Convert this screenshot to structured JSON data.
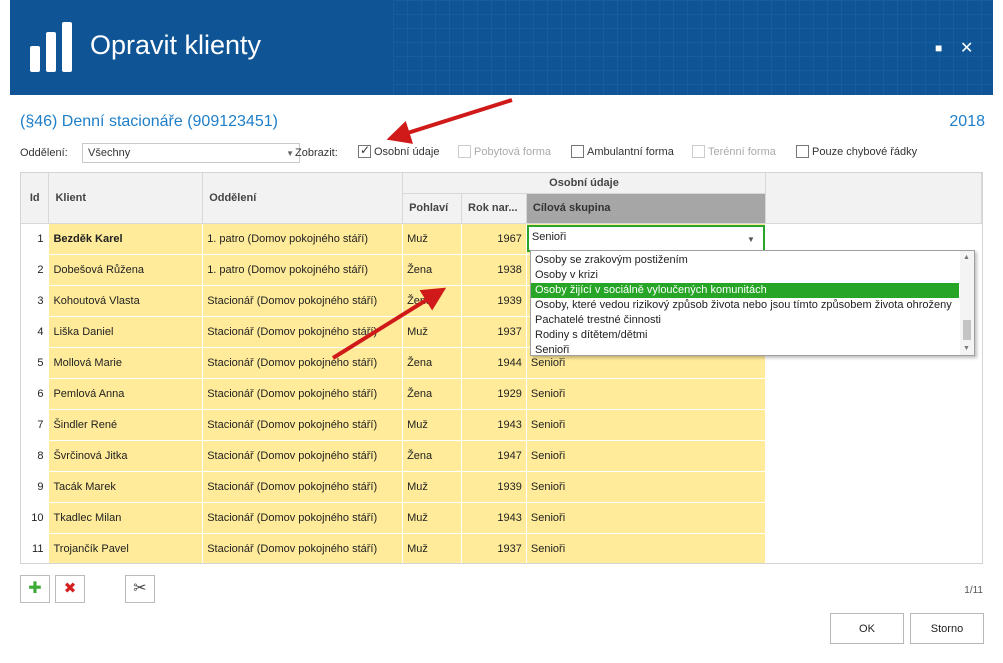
{
  "window": {
    "title": "Opravit klienty",
    "maximize_glyph": "■",
    "close_glyph": "✕"
  },
  "header": {
    "subtitle": "(§46) Denní stacionáře (909123451)",
    "year": "2018"
  },
  "filters": {
    "department_label": "Oddělení:",
    "department_value": "Všechny",
    "show_label": "Zobrazit:",
    "checkboxes": [
      {
        "label": "Osobní údaje",
        "checked": true,
        "disabled": false
      },
      {
        "label": "Pobytová forma",
        "checked": false,
        "disabled": true
      },
      {
        "label": "Ambulantní forma",
        "checked": false,
        "disabled": false
      },
      {
        "label": "Terénní forma",
        "checked": false,
        "disabled": true
      },
      {
        "label": "Pouze chybové řádky",
        "checked": false,
        "disabled": false
      }
    ]
  },
  "grid": {
    "headers": {
      "id": "Id",
      "client": "Klient",
      "department": "Oddělení",
      "group": "Osobní údaje",
      "gender": "Pohlaví",
      "birth_year": "Rok nar...",
      "target_group": "Cílová skupina"
    },
    "rows": [
      {
        "id": "1",
        "client": "Bezděk Karel",
        "department": "1. patro (Domov pokojného stáří)",
        "gender": "Muž",
        "year": "1967",
        "target": "Senioři"
      },
      {
        "id": "2",
        "client": "Dobešová Růžena",
        "department": "1. patro (Domov pokojného stáří)",
        "gender": "Žena",
        "year": "1938",
        "target": ""
      },
      {
        "id": "3",
        "client": "Kohoutová Vlasta",
        "department": "Stacionář (Domov pokojného stáří)",
        "gender": "Žena",
        "year": "1939",
        "target": ""
      },
      {
        "id": "4",
        "client": "Liška Daniel",
        "department": "Stacionář (Domov pokojného stáří)",
        "gender": "Muž",
        "year": "1937",
        "target": ""
      },
      {
        "id": "5",
        "client": "Mollová Marie",
        "department": "Stacionář (Domov pokojného stáří)",
        "gender": "Žena",
        "year": "1944",
        "target": "Senioři"
      },
      {
        "id": "6",
        "client": "Pemlová Anna",
        "department": "Stacionář (Domov pokojného stáří)",
        "gender": "Žena",
        "year": "1929",
        "target": "Senioři"
      },
      {
        "id": "7",
        "client": "Šindler René",
        "department": "Stacionář (Domov pokojného stáří)",
        "gender": "Muž",
        "year": "1943",
        "target": "Senioři"
      },
      {
        "id": "8",
        "client": "Švrčinová Jitka",
        "department": "Stacionář (Domov pokojného stáří)",
        "gender": "Žena",
        "year": "1947",
        "target": "Senioři"
      },
      {
        "id": "9",
        "client": "Tacák Marek",
        "department": "Stacionář (Domov pokojného stáří)",
        "gender": "Muž",
        "year": "1939",
        "target": "Senioři"
      },
      {
        "id": "10",
        "client": "Tkadlec Milan",
        "department": "Stacionář (Domov pokojného stáří)",
        "gender": "Muž",
        "year": "1943",
        "target": "Senioři"
      },
      {
        "id": "11",
        "client": "Trojančík Pavel",
        "department": "Stacionář (Domov pokojného stáří)",
        "gender": "Muž",
        "year": "1937",
        "target": "Senioři"
      }
    ]
  },
  "dropdown": {
    "items": [
      "Osoby se zrakovým postižením",
      "Osoby v krizi",
      "Osoby žijící v sociálně vyloučených komunitách",
      "Osoby, které vedou rizikový způsob života nebo jsou tímto způsobem života ohroženy",
      "Pachatelé trestné činnosti",
      "Rodiny s dítětem/dětmi",
      "Senioři"
    ],
    "selected_index": 2
  },
  "toolbar": {
    "add_glyph": "✚",
    "delete_glyph": "✖",
    "tools_glyph": "✂"
  },
  "pager": {
    "text": "1/11"
  },
  "buttons": {
    "ok": "OK",
    "cancel": "Storno"
  },
  "colors": {
    "titlebar": "#0f5596",
    "accent": "#1e7ec8",
    "row_highlight": "#ffeb99",
    "selection": "#27a527",
    "annotation_arrow": "#d01a1a"
  }
}
